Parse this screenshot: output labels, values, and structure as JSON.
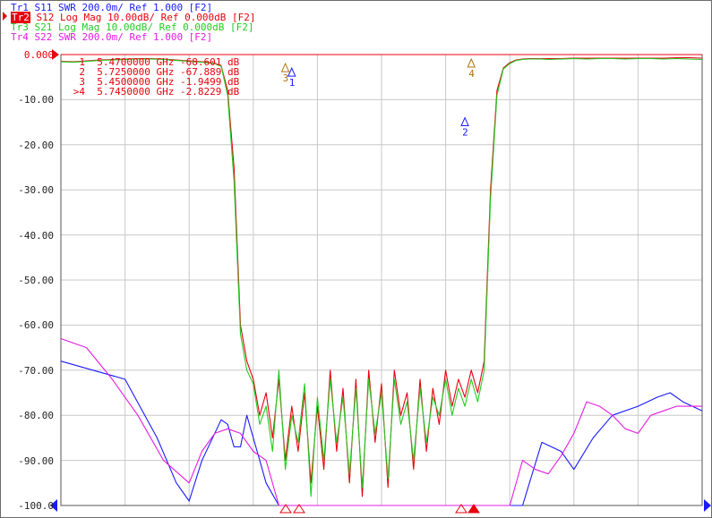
{
  "traces": [
    {
      "id": "Tr1",
      "label": "S11 SWR 200.0m/ Ref 1.000 [F2]",
      "color": "#1a1aff"
    },
    {
      "id": "Tr2",
      "label": "S12 Log Mag 10.00dB/ Ref 0.000dB [F2]",
      "color": "#e8000d",
      "active": true
    },
    {
      "id": "Tr3",
      "label": "S21 Log Mag 10.00dB/ Ref 0.000dB [F2]",
      "color": "#22cc22"
    },
    {
      "id": "Tr4",
      "label": "S22 SWR 200.0m/ Ref 1.000 [F2]",
      "color": "#e21de2"
    }
  ],
  "markers": [
    {
      "id": "1",
      "freq": "5.4700000 GHz",
      "value": "-68.601 dB"
    },
    {
      "id": "2",
      "freq": "5.7250000 GHz",
      "value": "-67.889 dB"
    },
    {
      "id": "3",
      "freq": "5.4500000 GHz",
      "value": "-1.9499 dB"
    },
    {
      "id": ">4",
      "freq": "5.7450000 GHz",
      "value": "-2.8229 dB"
    }
  ],
  "chart_data": {
    "type": "line",
    "title": "",
    "xlabel": "",
    "ylabel": "",
    "ylim": [
      -100,
      0
    ],
    "yticks": [
      "0.000",
      "-10.00",
      "-20.00",
      "-30.00",
      "-40.00",
      "-50.00",
      "-60.00",
      "-70.00",
      "-80.00",
      "-90.00",
      "-100.0"
    ],
    "grid": true,
    "marker_numbers": [
      "1",
      "2",
      "3",
      "4"
    ],
    "series": [
      {
        "trace": "Tr2",
        "color": "#e8000d",
        "x": [
          0,
          2,
          4,
          6,
          8,
          10,
          12,
          14,
          16,
          18,
          20,
          22,
          24,
          25,
          26,
          27,
          28,
          29,
          30,
          31,
          32,
          33,
          34,
          35,
          36,
          37,
          38,
          39,
          40,
          41,
          42,
          43,
          44,
          45,
          46,
          47,
          48,
          49,
          50,
          51,
          52,
          53,
          54,
          55,
          56,
          57,
          58,
          59,
          60,
          61,
          62,
          63,
          64,
          65,
          66,
          67,
          68,
          69,
          70,
          71,
          72,
          73,
          74,
          75,
          76,
          78,
          80,
          82,
          84,
          86,
          88,
          90,
          92,
          94,
          96,
          98,
          100
        ],
        "y": [
          -1.5,
          -1.6,
          -1.4,
          -1.2,
          -1.1,
          -1.0,
          -0.9,
          -0.9,
          -1.0,
          -1.2,
          -1.4,
          -1.6,
          -1.9,
          -2.5,
          -8,
          -25,
          -60,
          -68,
          -72,
          -80,
          -75,
          -85,
          -72,
          -90,
          -78,
          -88,
          -75,
          -95,
          -78,
          -92,
          -70,
          -88,
          -74,
          -95,
          -72,
          -98,
          -70,
          -86,
          -73,
          -96,
          -70,
          -80,
          -75,
          -92,
          -72,
          -88,
          -74,
          -82,
          -70,
          -78,
          -72,
          -76,
          -70,
          -75,
          -68,
          -30,
          -8,
          -3,
          -1.8,
          -1.2,
          -1.0,
          -0.9,
          -0.9,
          -0.9,
          -0.9,
          -0.9,
          -0.8,
          -0.8,
          -0.8,
          -0.8,
          -0.8,
          -0.8,
          -0.8,
          -0.8,
          -0.7,
          -0.7,
          -0.8
        ]
      },
      {
        "trace": "Tr3",
        "color": "#22cc22",
        "x": [
          0,
          2,
          4,
          6,
          8,
          10,
          12,
          14,
          16,
          18,
          20,
          22,
          24,
          25,
          26,
          27,
          28,
          29,
          30,
          31,
          32,
          33,
          34,
          35,
          36,
          37,
          38,
          39,
          40,
          41,
          42,
          43,
          44,
          45,
          46,
          47,
          48,
          49,
          50,
          51,
          52,
          53,
          54,
          55,
          56,
          57,
          58,
          59,
          60,
          61,
          62,
          63,
          64,
          65,
          66,
          67,
          68,
          69,
          70,
          71,
          72,
          73,
          74,
          75,
          76,
          78,
          80,
          82,
          84,
          86,
          88,
          90,
          92,
          94,
          96,
          98,
          100
        ],
        "y": [
          -1.6,
          -1.7,
          -1.5,
          -1.3,
          -1.2,
          -1.1,
          -1.0,
          -1.0,
          -1.1,
          -1.3,
          -1.5,
          -1.7,
          -2.0,
          -2.6,
          -9,
          -28,
          -62,
          -70,
          -73,
          -82,
          -78,
          -88,
          -70,
          -92,
          -80,
          -86,
          -73,
          -98,
          -76,
          -90,
          -72,
          -86,
          -76,
          -93,
          -74,
          -96,
          -72,
          -84,
          -75,
          -94,
          -72,
          -82,
          -77,
          -90,
          -74,
          -86,
          -76,
          -80,
          -72,
          -80,
          -74,
          -78,
          -72,
          -77,
          -70,
          -32,
          -9,
          -3.2,
          -2.0,
          -1.3,
          -1.1,
          -1.0,
          -1.0,
          -1.0,
          -1.1,
          -1.0,
          -0.9,
          -1.0,
          -0.9,
          -0.9,
          -1.0,
          -0.9,
          -0.9,
          -1.0,
          -0.9,
          -1.0,
          -1.1
        ]
      },
      {
        "trace": "Tr1",
        "color": "#1a1aff",
        "x": [
          0,
          5,
          10,
          15,
          18,
          20,
          22,
          25,
          26,
          27,
          28,
          29,
          30,
          31,
          32,
          34,
          36,
          38,
          40,
          42,
          44,
          46,
          48,
          50,
          52,
          54,
          55,
          56,
          57,
          58,
          60,
          62,
          64,
          66,
          68,
          70,
          72,
          75,
          78,
          80,
          83,
          86,
          90,
          93,
          95,
          97,
          100
        ],
        "y": [
          -68,
          -70,
          -72,
          -85,
          -95,
          -99,
          -90,
          -81,
          -82,
          -87,
          -87,
          -80,
          -85,
          -90,
          -95,
          -100,
          -100,
          -100,
          -100,
          -100,
          -100,
          -100,
          -100,
          -100,
          -100,
          -100,
          -100,
          -100,
          -100,
          -100,
          -100,
          -100,
          -100,
          -100,
          -100,
          -100,
          -100,
          -86,
          -88,
          -92,
          -85,
          -80,
          -78,
          -76,
          -75,
          -77,
          -79
        ]
      },
      {
        "trace": "Tr4",
        "color": "#e21de2",
        "x": [
          0,
          4,
          8,
          12,
          16,
          20,
          22,
          24,
          26,
          28,
          30,
          32,
          34,
          36,
          38,
          40,
          42,
          44,
          46,
          48,
          50,
          52,
          54,
          56,
          58,
          60,
          62,
          64,
          66,
          68,
          70,
          72,
          74,
          76,
          78,
          80,
          82,
          84,
          86,
          88,
          90,
          92,
          94,
          96,
          98,
          100
        ],
        "y": [
          -63,
          -65,
          -72,
          -80,
          -90,
          -95,
          -88,
          -84,
          -83,
          -84,
          -88,
          -90,
          -100,
          -100,
          -100,
          -100,
          -100,
          -100,
          -100,
          -100,
          -100,
          -100,
          -100,
          -100,
          -100,
          -100,
          -100,
          -100,
          -100,
          -100,
          -100,
          -90,
          -92,
          -93,
          -89,
          -84,
          -77,
          -78,
          -80,
          -83,
          -84,
          -80,
          -79,
          -78,
          -78,
          -78
        ]
      }
    ]
  }
}
